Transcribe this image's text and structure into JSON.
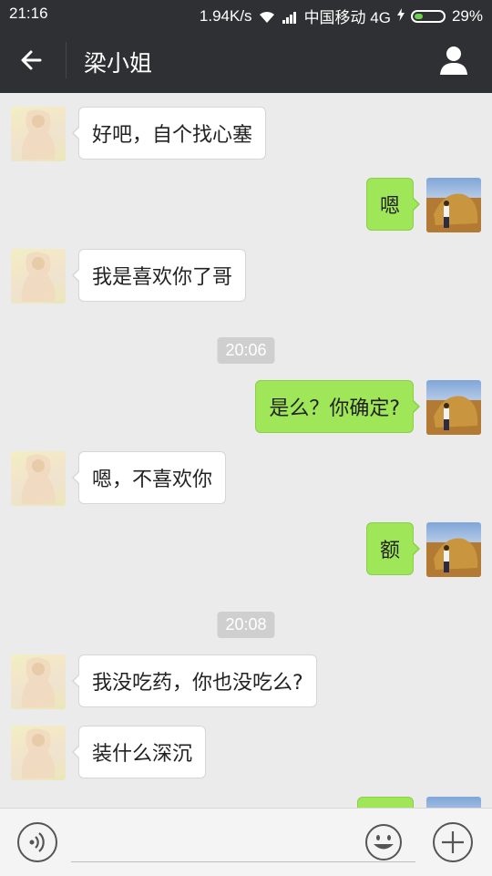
{
  "status_bar": {
    "time": "21:16",
    "speed": "1.94K/s",
    "carrier": "中国移动 4G",
    "battery": "29%",
    "battery_fraction": 0.29
  },
  "header": {
    "title": "梁小姐",
    "back_icon": "arrow-left-icon",
    "profile_icon": "person-icon"
  },
  "chat": {
    "messages": [
      {
        "side": "left",
        "text": "好吧，自个找心塞"
      },
      {
        "side": "right",
        "text": "嗯"
      },
      {
        "side": "left",
        "text": "我是喜欢你了哥"
      },
      {
        "side": "time",
        "text": "20:06"
      },
      {
        "side": "right",
        "text": "是么？你确定?"
      },
      {
        "side": "left",
        "text": "嗯，不喜欢你"
      },
      {
        "side": "right",
        "text": "额"
      },
      {
        "side": "time",
        "text": "20:08"
      },
      {
        "side": "left",
        "text": "我没吃药，你也没吃么?"
      },
      {
        "side": "left",
        "text": "装什么深沉"
      },
      {
        "side": "right",
        "text": ""
      }
    ]
  },
  "input_bar": {
    "voice_icon": "voice-icon",
    "emoji_icon": "smiley-icon",
    "plus_icon": "plus-icon"
  },
  "colors": {
    "header_bg": "#2f3033",
    "chat_bg": "#ebebeb",
    "sent_bubble": "#9fe658",
    "received_bubble": "#ffffff",
    "timestamp_bg": "#cfcfcf"
  }
}
